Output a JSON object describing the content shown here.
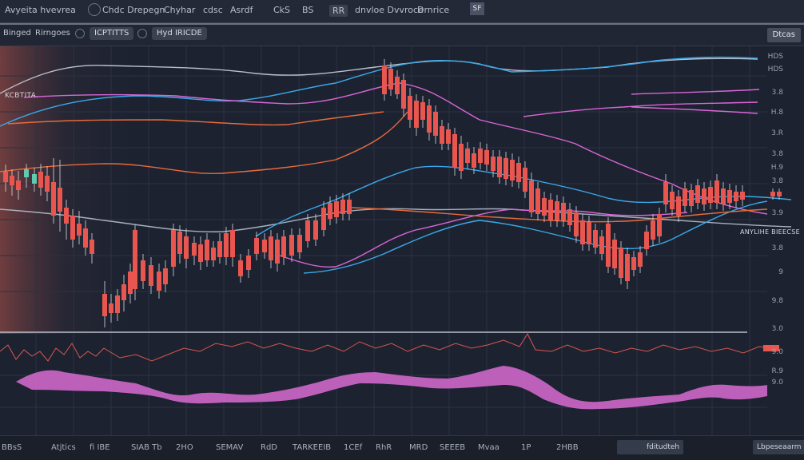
{
  "menu": {
    "title": "Avyeita hvevrea",
    "items": [
      "Chdc Drepegn",
      "Chyhar",
      "cdsc",
      "Asrdf",
      "CkS",
      "BS",
      "RR",
      "dnvloe Dvvroce",
      "Drnrice"
    ],
    "corner": "SF"
  },
  "toolbar": {
    "items": [
      "Binged",
      "Rirngoes"
    ],
    "pills": [
      "ICPTITTS",
      "Hyd IRICDE"
    ],
    "right_button": "Dtcas"
  },
  "chart": {
    "series_label": "KCBTITA.",
    "annotation": "ANYLIHE BIEECSE",
    "price_labels": [
      "HDS",
      "HDS",
      "3.8",
      "H.8",
      "3.R",
      "3.8",
      "H.9",
      "3.8",
      "3.9",
      "3.8",
      "9",
      "9.8",
      "3.0",
      "9.0",
      "R.9",
      "9.0"
    ],
    "colors": {
      "up": "#5fc9b1",
      "down": "#e8564f",
      "line_blue": "#3aa8e8",
      "line_pink": "#d966d6",
      "line_orange": "#e86a3c",
      "oscillator": "#d86bd2"
    }
  },
  "bottom": {
    "items": [
      "BBsS",
      "Atjtics",
      "fi IBE",
      "SIAB Tb",
      "2HO",
      "SEMAV",
      "RdD",
      "TARKEEIB",
      "1CEf",
      "RhR",
      "MRD",
      "SEEEB",
      "Mvaa",
      "1P",
      "2HBB"
    ],
    "buttons": [
      "",
      "fditudteh",
      "Lbpeseaarm"
    ]
  }
}
